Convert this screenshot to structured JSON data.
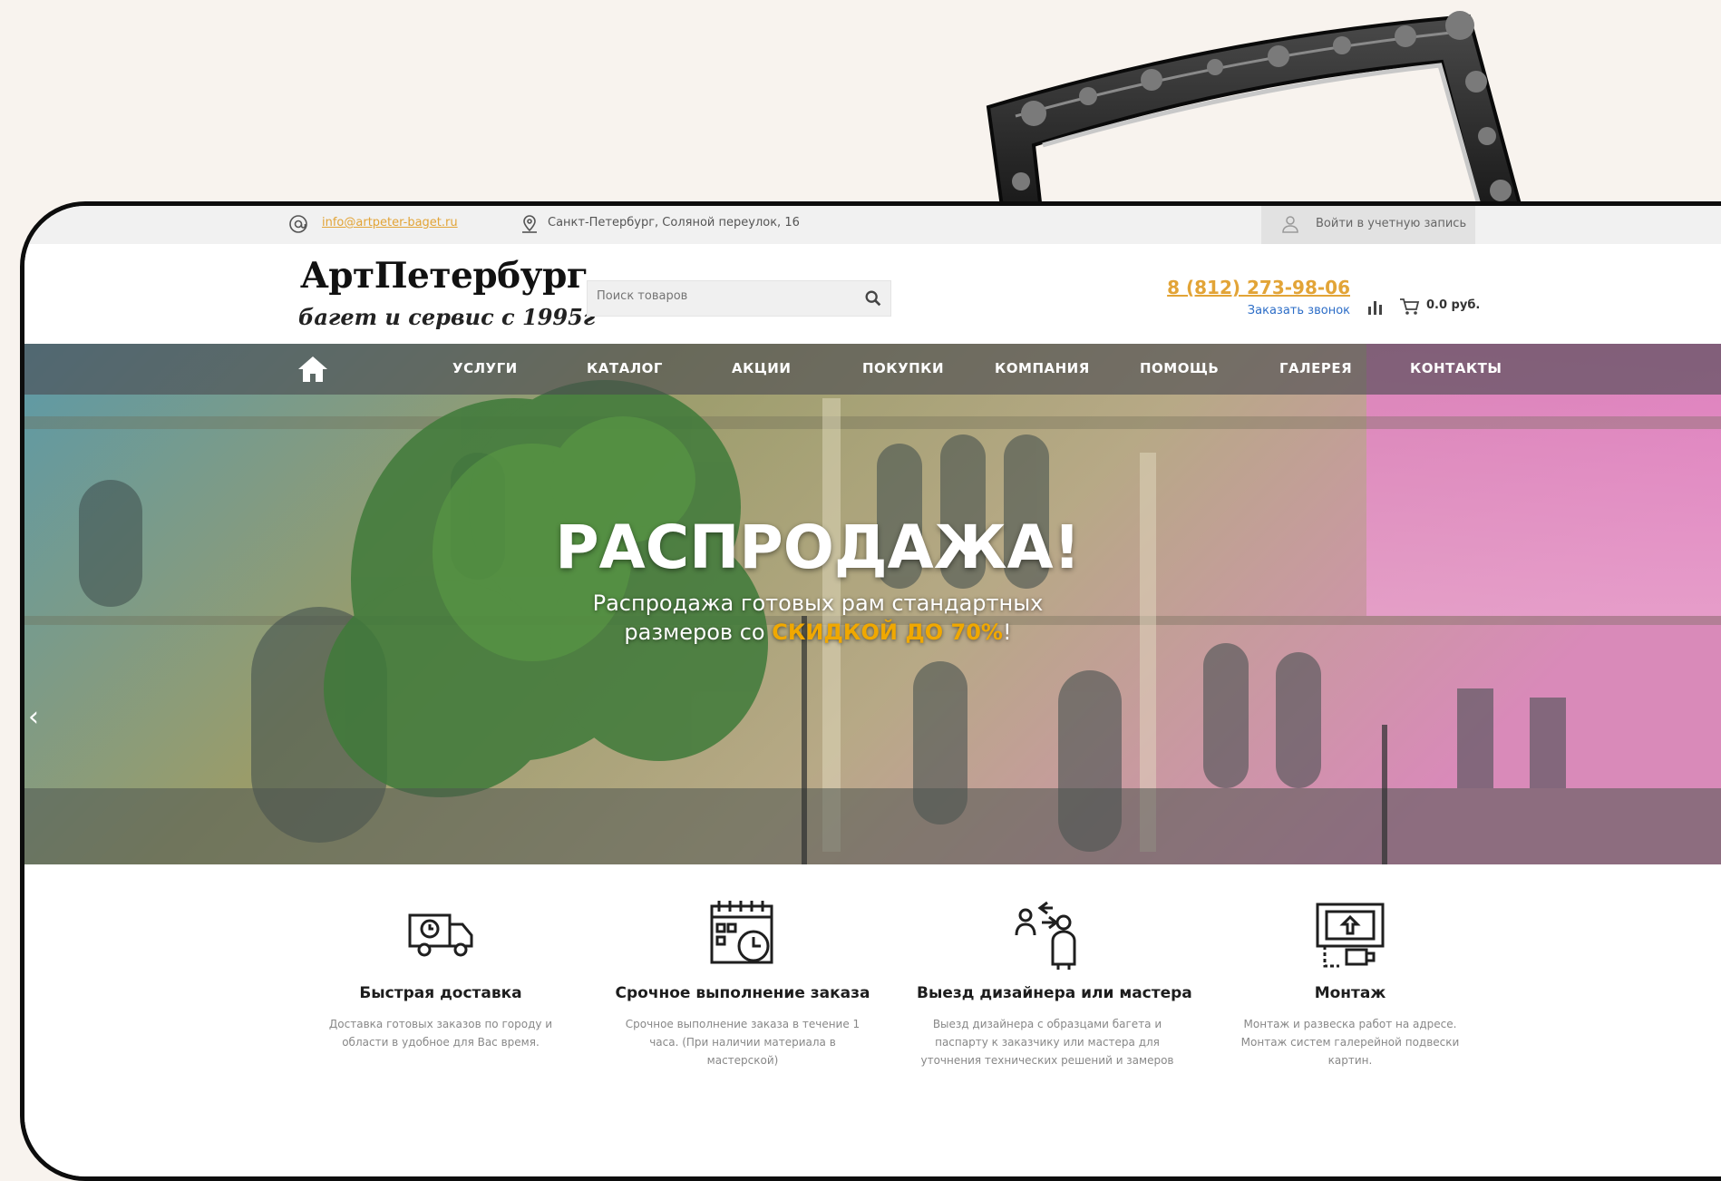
{
  "topbar": {
    "email": "info@artpeter-baget.ru",
    "address": "Санкт-Петербург, Соляной переулок, 16",
    "login_label": "Войти в учетную запись"
  },
  "header": {
    "logo_line1": "АртПетербург",
    "logo_line2": "багет и сервис с 1995г",
    "search_placeholder": "Поиск товаров",
    "phone": "8 (812) 273-98-06",
    "callback_label": "Заказать звонок",
    "cart_total": "0.0 руб."
  },
  "nav": {
    "items": [
      "УСЛУГИ",
      "КАТАЛОГ",
      "АКЦИИ",
      "ПОКУПКИ",
      "КОМПАНИЯ",
      "ПОМОЩЬ",
      "ГАЛЕРЕЯ",
      "КОНТАКТЫ"
    ]
  },
  "hero": {
    "title": "РАСПРОДАЖА!",
    "subtitle_line1": "Распродажа готовых рам стандартных",
    "subtitle_line2_pre": "размеров со ",
    "subtitle_accent": "СКИДКОЙ ДО 70%",
    "subtitle_line2_post": "!",
    "arrow_left": "‹"
  },
  "features": [
    {
      "title": "Быстрая доставка",
      "desc": "Доставка готовых заказов по городу и области в удобное для Вас время."
    },
    {
      "title": "Срочное выполнение заказа",
      "desc": "Срочное выполнение заказа в течение 1 часа. (При наличии материала в мастерской)"
    },
    {
      "title": "Выезд дизайнера или мастера",
      "desc": "Выезд дизайнера с образцами багета и паспарту к заказчику или мастера для уточнения технических решений и замеров"
    },
    {
      "title": "Монтаж",
      "desc": "Монтаж и развеска работ на адресе. Монтаж систем галерейной подвески картин."
    }
  ],
  "icons": {
    "email": "at-sign-icon",
    "address": "location-pin-icon",
    "login": "user-icon",
    "search": "search-icon",
    "stats": "bar-chart-icon",
    "cart": "cart-icon",
    "home": "home-icon",
    "features": [
      "delivery-truck-icon",
      "calendar-clock-icon",
      "designer-visit-icon",
      "installation-icon"
    ]
  },
  "colors": {
    "accent": "#e2a437",
    "link_blue": "#2c6dc7",
    "page_bg": "#f8f3ee"
  }
}
